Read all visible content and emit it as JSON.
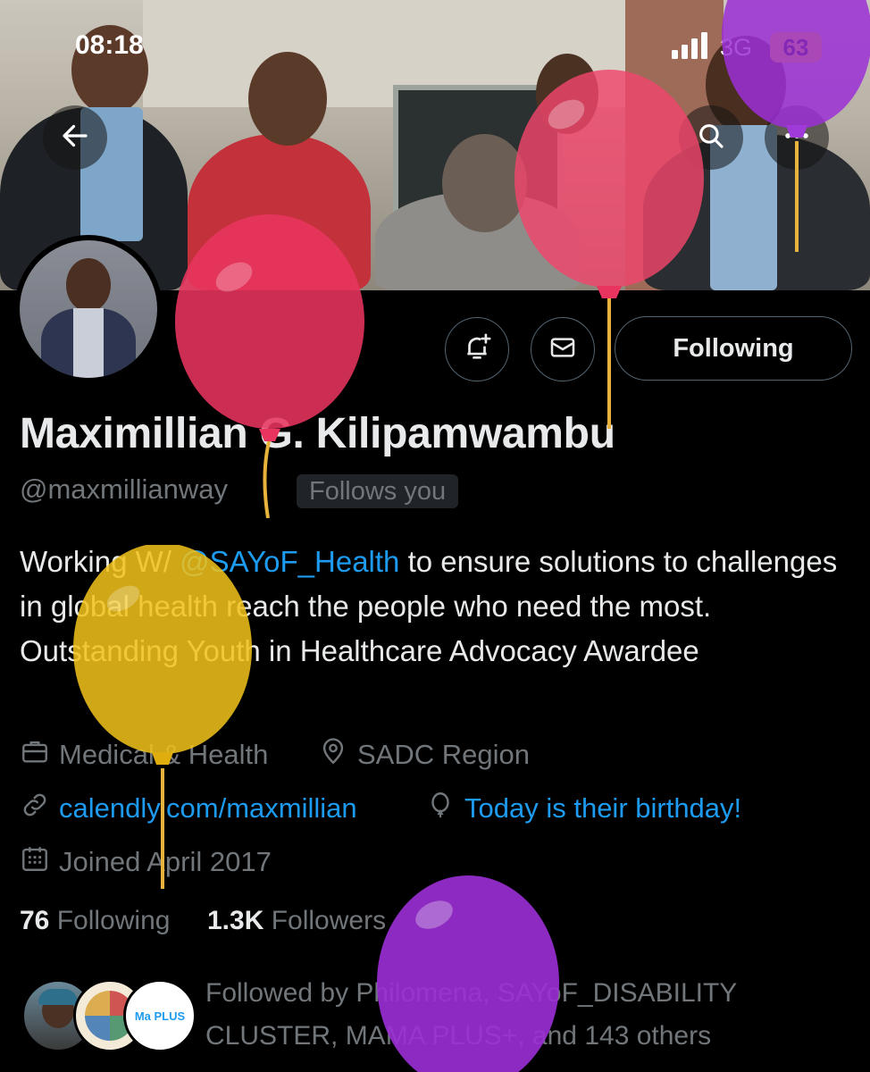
{
  "status_bar": {
    "time": "08:18",
    "network": "3G",
    "battery": "63"
  },
  "profile": {
    "display_name": "Maximillian G. Kilipamwambu",
    "handle": "@maxmillianway",
    "follows_you": "Follows you",
    "bio": {
      "prefix": "Working W/ ",
      "mention": "@SAYoF_Health",
      "suffix": " to ensure solutions to challenges in global health reach the people who need the most. Outstanding Youth in Healthcare Advocacy Awardee"
    },
    "category": "Medical & Health",
    "location": "SADC Region",
    "website": "calendly.com/maxmillian",
    "birthday": "Today is their birthday!",
    "joined": "Joined April 2017",
    "following_count": "76",
    "following_label": "Following",
    "followers_count": "1.3K",
    "followers_label": "Followers",
    "followed_by": "Followed by Philomena, SAYoF_DISABILITY CLUSTER, MAMA PLUS+, and 143 others",
    "mini_avatar_text": "Ma PLUS"
  },
  "actions": {
    "following_button": "Following"
  },
  "icons": {
    "back": "back-arrow-icon",
    "search": "search-icon",
    "more": "more-icon",
    "notify": "bell-plus-icon",
    "message": "envelope-icon",
    "category": "briefcase-icon",
    "location": "location-pin-icon",
    "link": "link-icon",
    "birthday": "balloon-icon",
    "calendar": "calendar-icon"
  },
  "colors": {
    "accent": "#1d9bf0",
    "secondary_text": "#71767b",
    "battery_badge": "#ffd60a",
    "balloon_pink": "#e8345f",
    "balloon_yellow": "#f2c21a",
    "balloon_purple": "#9b2fd6"
  }
}
